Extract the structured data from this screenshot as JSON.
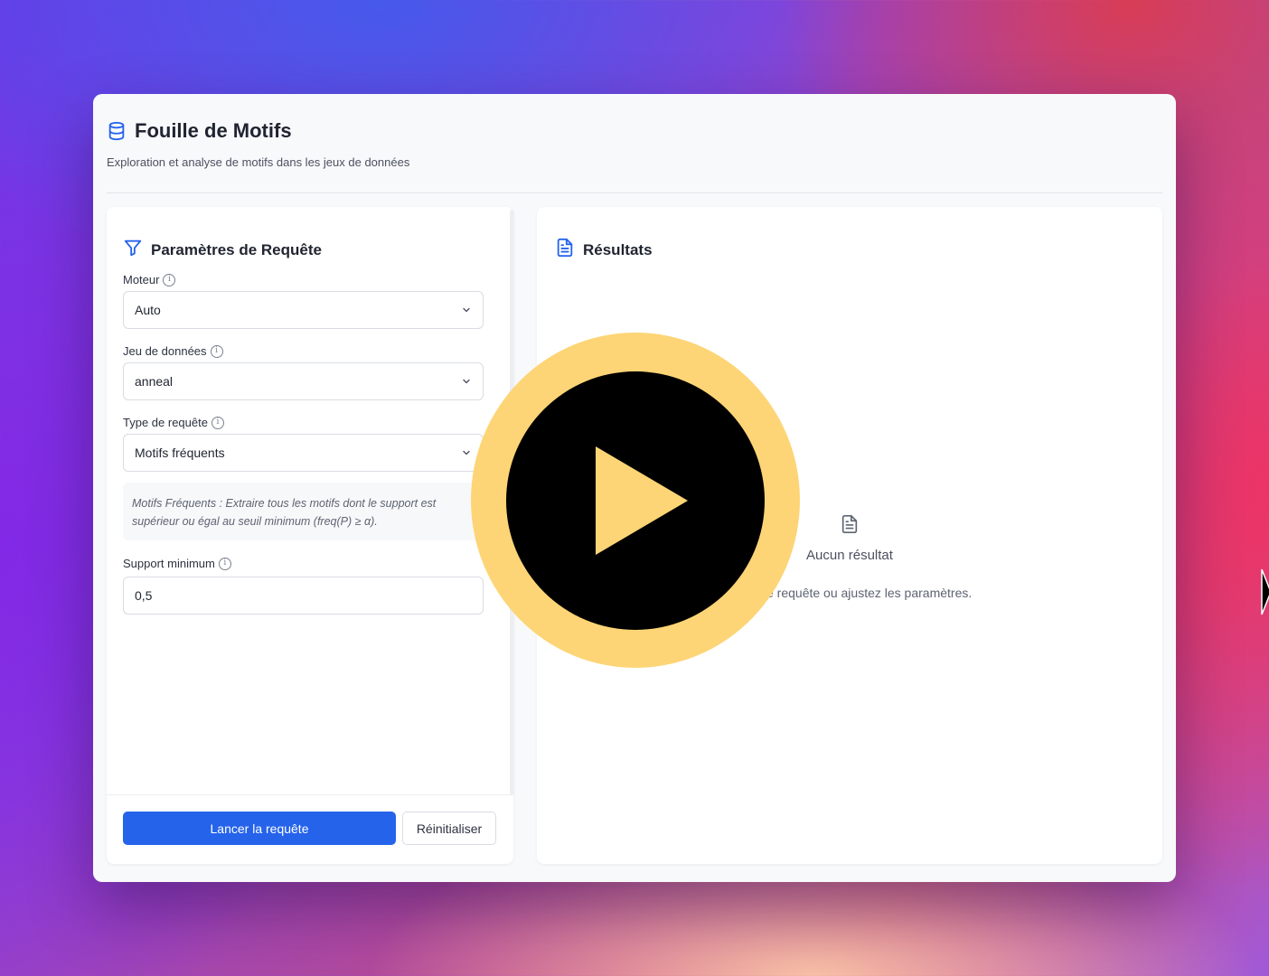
{
  "app": {
    "title": "Fouille de Motifs",
    "subtitle": "Exploration et analyse de motifs dans les jeux de données"
  },
  "params": {
    "heading": "Paramètres de Requête",
    "engine": {
      "label": "Moteur",
      "value": "Auto"
    },
    "dataset": {
      "label": "Jeu de données",
      "value": "anneal"
    },
    "query_type": {
      "label": "Type de requête",
      "value": "Motifs fréquents"
    },
    "description": "Motifs Fréquents : Extraire tous les motifs dont le support est supérieur ou égal au seuil minimum (freq(P) ≥ α).",
    "min_support": {
      "label": "Support minimum",
      "value": "0,5"
    },
    "run_label": "Lancer la requête",
    "reset_label": "Réinitialiser"
  },
  "results": {
    "heading": "Résultats",
    "empty_title": "Aucun résultat",
    "empty_hint_visible": "e requête ou ajustez les paramètres."
  },
  "icons": {
    "title_icon": "database-icon",
    "params_icon": "filter-icon",
    "results_icon": "file-text-icon",
    "empty_icon": "file-text-icon",
    "info_icon": "info-icon",
    "overlay_icon": "play-icon"
  },
  "colors": {
    "accent": "#2563eb",
    "overlay_ring": "#fdd576",
    "overlay_center": "#000000"
  }
}
